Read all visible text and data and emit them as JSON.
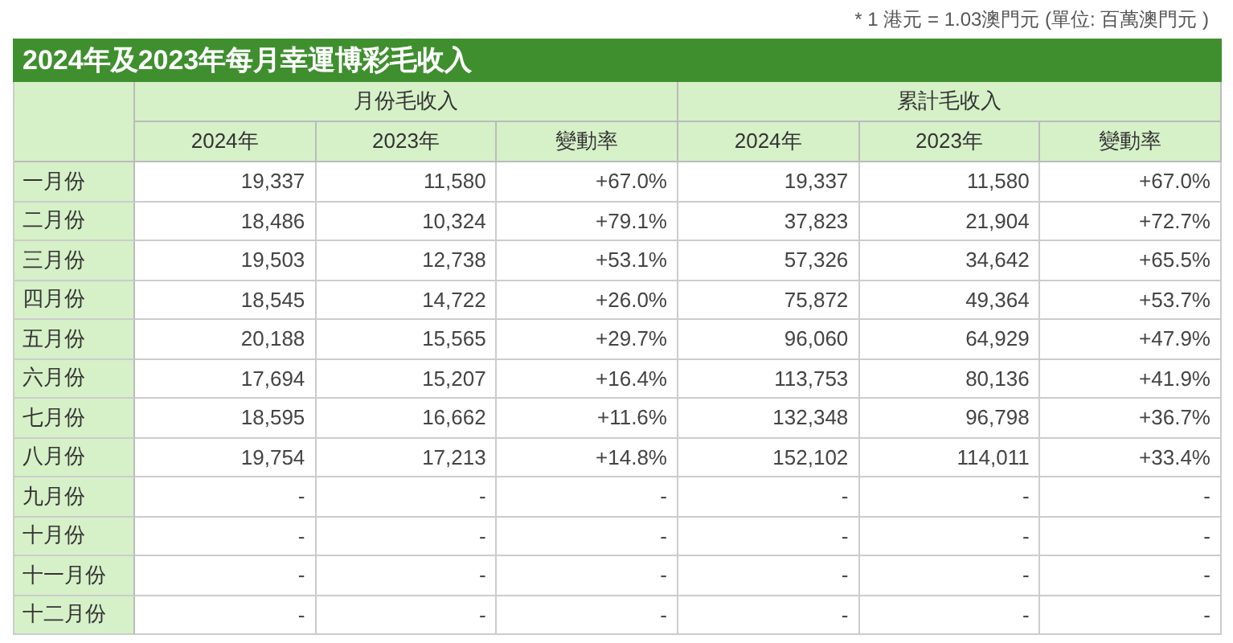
{
  "note": "* 1 港元 = 1.03澳門元 (單位: 百萬澳門元 )",
  "table": {
    "title": "2024年及2023年每月幸運博彩毛收入",
    "groups": [
      "月份毛收入",
      "累計毛收入"
    ],
    "columns": [
      "2024年",
      "2023年",
      "變動率",
      "2024年",
      "2023年",
      "變動率"
    ],
    "rows": [
      {
        "month": "一月份",
        "cells": [
          "19,337",
          "11,580",
          "+67.0%",
          "19,337",
          "11,580",
          "+67.0%"
        ]
      },
      {
        "month": "二月份",
        "cells": [
          "18,486",
          "10,324",
          "+79.1%",
          "37,823",
          "21,904",
          "+72.7%"
        ]
      },
      {
        "month": "三月份",
        "cells": [
          "19,503",
          "12,738",
          "+53.1%",
          "57,326",
          "34,642",
          "+65.5%"
        ]
      },
      {
        "month": "四月份",
        "cells": [
          "18,545",
          "14,722",
          "+26.0%",
          "75,872",
          "49,364",
          "+53.7%"
        ]
      },
      {
        "month": "五月份",
        "cells": [
          "20,188",
          "15,565",
          "+29.7%",
          "96,060",
          "64,929",
          "+47.9%"
        ]
      },
      {
        "month": "六月份",
        "cells": [
          "17,694",
          "15,207",
          "+16.4%",
          "113,753",
          "80,136",
          "+41.9%"
        ]
      },
      {
        "month": "七月份",
        "cells": [
          "18,595",
          "16,662",
          "+11.6%",
          "132,348",
          "96,798",
          "+36.7%"
        ]
      },
      {
        "month": "八月份",
        "cells": [
          "19,754",
          "17,213",
          "+14.8%",
          "152,102",
          "114,011",
          "+33.4%"
        ]
      },
      {
        "month": "九月份",
        "cells": [
          "-",
          "-",
          "-",
          "-",
          "-",
          "-"
        ]
      },
      {
        "month": "十月份",
        "cells": [
          "-",
          "-",
          "-",
          "-",
          "-",
          "-"
        ]
      },
      {
        "month": "十一月份",
        "cells": [
          "-",
          "-",
          "-",
          "-",
          "-",
          "-"
        ]
      },
      {
        "month": "十二月份",
        "cells": [
          "-",
          "-",
          "-",
          "-",
          "-",
          "-"
        ]
      }
    ]
  }
}
